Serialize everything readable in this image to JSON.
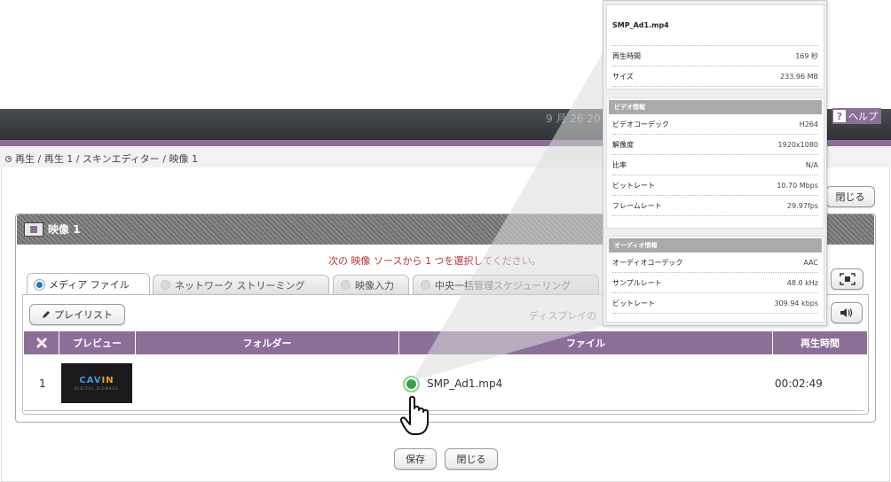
{
  "header": {
    "date_text": "9 月 26 20",
    "help_label": "ヘルプ",
    "help_icon": "?"
  },
  "breadcrumb": {
    "text": "再生 / 再生 1 / スキンエディター / 映像 1"
  },
  "top_close_label": "閉じる",
  "panel": {
    "title": "映像 1",
    "notice": "次の 映像 ソースから 1 つを選択してください。",
    "tabs": [
      {
        "label": "メディア ファイル"
      },
      {
        "label": "ネットワーク ストリーミング"
      },
      {
        "label": "映像入力"
      },
      {
        "label": "中央一括管理スケジューリング"
      }
    ],
    "playlist_label": "プレイリスト",
    "display_label": "ディスプレイの",
    "table": {
      "headers": [
        "プレビュー",
        "フォルダー",
        "ファイル",
        "再生時間"
      ],
      "rows": [
        {
          "index": "1",
          "thumb_logo_a": "CAV",
          "thumb_logo_b": "IN",
          "thumb_tag": "DIGITAL SIGNAGE",
          "folder": "",
          "file": "SMP_Ad1.mp4",
          "duration": "00:02:49"
        }
      ]
    }
  },
  "footer": {
    "save_label": "保存",
    "close_label": "閉じる"
  },
  "popup": {
    "file_name": "SMP_Ad1.mp4",
    "general": [
      {
        "k": "再生時間",
        "v": "169 秒"
      },
      {
        "k": "サイズ",
        "v": "233.96 MB"
      }
    ],
    "video": {
      "title": "ビデオ情報",
      "rows": [
        {
          "k": "ビデオコーデック",
          "v": "H264"
        },
        {
          "k": "解像度",
          "v": "1920x1080"
        },
        {
          "k": "比率",
          "v": "N/A"
        },
        {
          "k": "ビットレート",
          "v": "10.70 Mbps"
        },
        {
          "k": "フレームレート",
          "v": "29.97fps"
        }
      ]
    },
    "audio": {
      "title": "オーディオ情報",
      "rows": [
        {
          "k": "オーディオコーデック",
          "v": "AAC"
        },
        {
          "k": "サンプルレート",
          "v": "48.0 kHz"
        },
        {
          "k": "ビットレート",
          "v": "309.94 kbps"
        }
      ]
    }
  },
  "colors": {
    "accent": "#8c6f98",
    "header_dark": "#2e3034",
    "notice": "#b33333",
    "status_ok": "#3aa048"
  }
}
